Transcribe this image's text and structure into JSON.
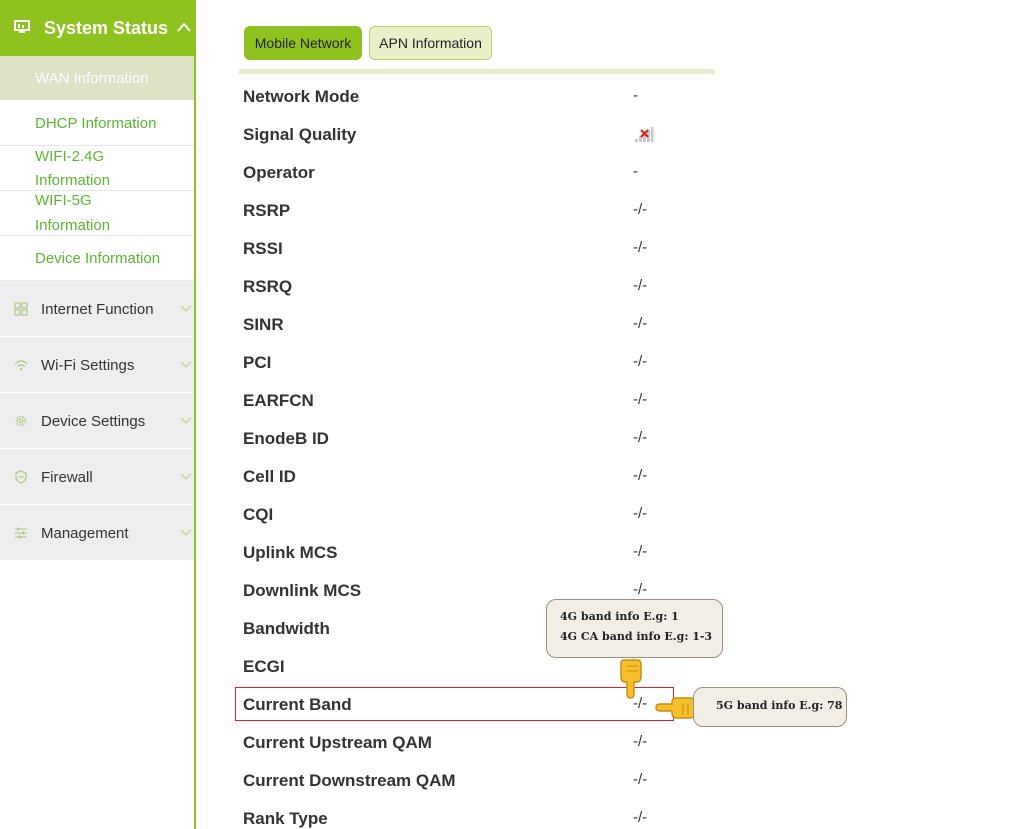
{
  "sidebar": {
    "header_label": "System Status",
    "sub_items": [
      {
        "label": "WAN Information"
      },
      {
        "label": "DHCP Information"
      },
      {
        "label": "WIFI-2.4G",
        "label2": "Information"
      },
      {
        "label": "WIFI-5G",
        "label2": "Information"
      },
      {
        "label": "Device Information"
      }
    ],
    "menu": [
      {
        "label": "Internet Function",
        "icon": "grid-icon"
      },
      {
        "label": "Wi-Fi Settings",
        "icon": "wifi-icon"
      },
      {
        "label": "Device Settings",
        "icon": "gear-icon"
      },
      {
        "label": "Firewall",
        "icon": "shield-icon"
      },
      {
        "label": "Management",
        "icon": "sliders-icon"
      }
    ]
  },
  "tabs": [
    {
      "label": "Mobile Network",
      "active": true
    },
    {
      "label": "APN Information",
      "active": false
    }
  ],
  "rows": [
    {
      "label": "Network Mode",
      "value": "-"
    },
    {
      "label": "Signal Quality",
      "value": ""
    },
    {
      "label": "Operator",
      "value": "-"
    },
    {
      "label": "RSRP",
      "value": "-/-"
    },
    {
      "label": "RSSI",
      "value": "-/-"
    },
    {
      "label": "RSRQ",
      "value": "-/-"
    },
    {
      "label": "SINR",
      "value": "-/-"
    },
    {
      "label": "PCI",
      "value": "-/-"
    },
    {
      "label": "EARFCN",
      "value": "-/-"
    },
    {
      "label": "EnodeB ID",
      "value": "-/-"
    },
    {
      "label": "Cell ID",
      "value": "-/-"
    },
    {
      "label": "CQI",
      "value": "-/-"
    },
    {
      "label": "Uplink MCS",
      "value": "-/-"
    },
    {
      "label": "Downlink MCS",
      "value": "-/-"
    },
    {
      "label": "Bandwidth",
      "value": ""
    },
    {
      "label": "ECGI",
      "value": ""
    },
    {
      "label": "Current Band",
      "value": "-/-"
    },
    {
      "label": "Current Upstream QAM",
      "value": "-/-"
    },
    {
      "label": "Current Downstream QAM",
      "value": "-/-"
    },
    {
      "label": "Rank Type",
      "value": "-/-"
    }
  ],
  "annotations": {
    "tip_4g_line1": "4G band info E.g: 1",
    "tip_4g_line2": "4G CA band info E.g: 1-3",
    "tip_5g": "5G band info E.g: 78"
  },
  "colors": {
    "accent": "#8dc21f",
    "link": "#5cb531",
    "highlight": "#d4242b"
  }
}
